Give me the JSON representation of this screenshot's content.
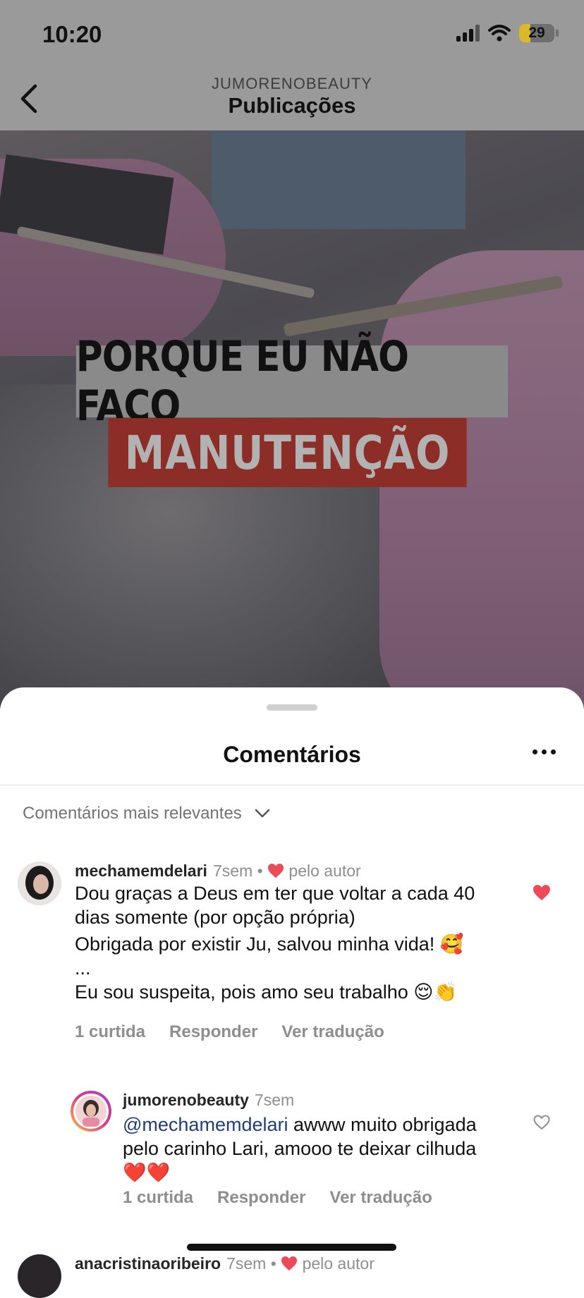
{
  "status_bar": {
    "time": "10:20",
    "battery": "29"
  },
  "header": {
    "account": "JUMORENOBEAUTY",
    "title": "Publicações"
  },
  "post": {
    "overlay_line1": "PORQUE EU NÃO FAÇO",
    "overlay_line2": "MANUTENÇÃO"
  },
  "comments_sheet": {
    "title": "Comentários",
    "sort_label": "Comentários mais relevantes",
    "comments": [
      {
        "username": "mechamemdelari",
        "time": "7sem",
        "liked_by_author": "pelo autor",
        "lines": [
          "Dou graças a Deus em ter que voltar a cada 40",
          "dias somente (por opção própria)",
          "Obrigada por existir Ju, salvou minha vida! 🥰",
          "...",
          "Eu sou suspeita, pois amo seu trabalho 😌👏"
        ],
        "likes": "1 curtida",
        "reply": "Responder",
        "translate": "Ver tradução"
      },
      {
        "username": "jumorenobeauty",
        "time": "7sem",
        "mention": "@mechamemdelari",
        "lines": [
          " awww muito obrigada",
          "pelo carinho Lari, amooo te deixar cilhuda",
          "❤️❤️"
        ],
        "likes": "1 curtida",
        "reply": "Responder",
        "translate": "Ver tradução"
      },
      {
        "username": "anacristinaoribeiro",
        "time": "7sem",
        "liked_by_author": "pelo autor"
      }
    ]
  },
  "colors": {
    "like_red": "#ed4956",
    "mention_blue": "#1e3f7a",
    "muted_gray": "#8e8e8e"
  }
}
